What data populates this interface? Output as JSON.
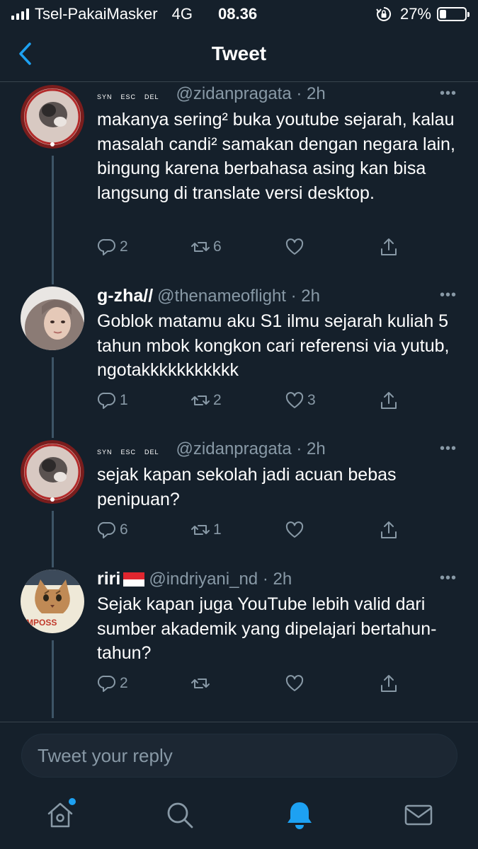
{
  "status_bar": {
    "carrier": "Tsel-PakaiMasker",
    "network": "4G",
    "time": "08.36",
    "battery": "27%",
    "battery_level": 0.27
  },
  "header": {
    "title": "Tweet"
  },
  "tweets": [
    {
      "name": "",
      "keys": [
        "SYN",
        "ESC",
        "DEL"
      ],
      "handle": "@zidanpragata · 2h",
      "text": "makanya sering² buka youtube sejarah, kalau masalah candi² samakan dengan negara lain, bingung karena berbahasa asing kan bisa langsung di translate versi desktop.",
      "replies": "2",
      "retweets": "6",
      "likes": ""
    },
    {
      "name": "g-zha//",
      "handle": "@thenameoflight · 2h",
      "text": "Goblok matamu aku S1 ilmu sejarah kuliah 5 tahun mbok kongkon cari referensi via yutub, ngotakkkkkkkkkkk",
      "replies": "1",
      "retweets": "2",
      "likes": "3"
    },
    {
      "name": "",
      "keys": [
        "SYN",
        "ESC",
        "DEL"
      ],
      "handle": "@zidanpragata · 2h",
      "text": "sejak kapan sekolah jadi acuan bebas penipuan?",
      "replies": "6",
      "retweets": "1",
      "likes": ""
    },
    {
      "name": "riri",
      "flag": "indonesia-flag",
      "handle": "@indriyani_nd · 2h",
      "text": "Sejak kapan juga YouTube lebih valid dari sumber akademik yang dipelajari bertahun-tahun?",
      "replies": "2",
      "retweets": "",
      "likes": ""
    }
  ],
  "avatar_texts": {
    "cat_caption": "MPOSS"
  },
  "reply_box": {
    "placeholder": "Tweet your reply"
  },
  "tab_bar": {
    "items": [
      "home-icon",
      "search-icon",
      "notifications-icon",
      "messages-icon"
    ],
    "active": "notifications-icon"
  },
  "colors": {
    "background": "#15202b",
    "accent": "#1da1f2",
    "secondary_text": "#8899a6",
    "divider": "#38444d"
  }
}
